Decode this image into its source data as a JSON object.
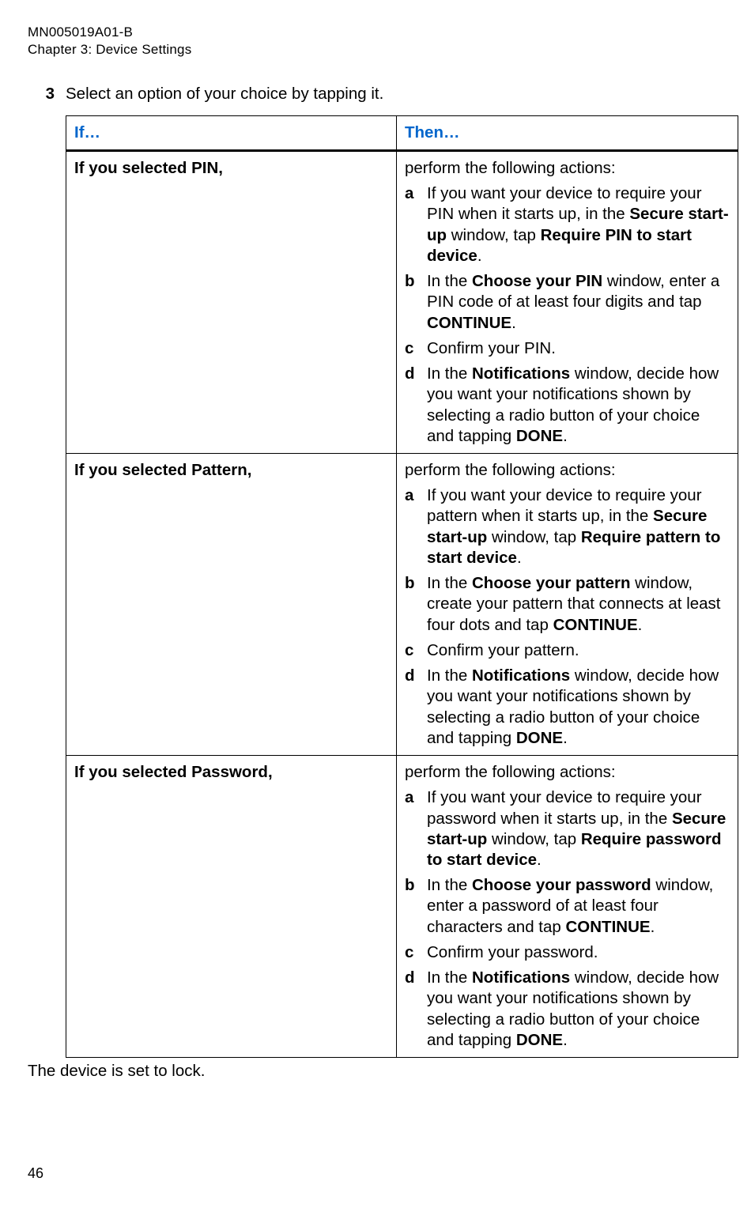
{
  "header": {
    "doc_id": "MN005019A01-B",
    "chapter": "Chapter 3:  Device Settings"
  },
  "step": {
    "num": "3",
    "text": "Select an option of your choice by tapping it."
  },
  "table": {
    "h1": "If…",
    "h2": "Then…",
    "rows": [
      {
        "if": "If you selected PIN,",
        "lead": "perform the following actions:",
        "items": [
          {
            "marker": "a",
            "pre": "If you want your device to require your PIN when it starts up, in the ",
            "b1": "Secure start-up",
            "mid1": " window, tap ",
            "b2": "Require PIN to start device",
            "post": "."
          },
          {
            "marker": "b",
            "pre": "In the ",
            "b1": "Choose your PIN",
            "mid1": " window, enter a PIN code of at least four digits and tap ",
            "b2": "CONTINUE",
            "post": "."
          },
          {
            "marker": "c",
            "text": "Confirm your PIN."
          },
          {
            "marker": "d",
            "pre": "In the ",
            "b1": "Notifications",
            "mid1": " window, decide how you want your notifications shown by selecting a radio button of your choice and tapping ",
            "b2": "DONE",
            "post": "."
          }
        ]
      },
      {
        "if": "If you selected Pattern,",
        "lead": "perform the following actions:",
        "items": [
          {
            "marker": "a",
            "pre": "If you want your device to require your pattern when it starts up, in the ",
            "b1": "Secure start-up",
            "mid1": " window, tap ",
            "b2": "Require pattern to start device",
            "post": "."
          },
          {
            "marker": "b",
            "pre": "In the ",
            "b1": "Choose your pattern",
            "mid1": " window, create your pattern that connects at least four dots and tap ",
            "b2": "CONTINUE",
            "post": "."
          },
          {
            "marker": "c",
            "text": "Confirm your pattern."
          },
          {
            "marker": "d",
            "pre": "In the ",
            "b1": "Notifications",
            "mid1": " window, decide how you want your notifications shown by selecting a radio button of your choice and tapping ",
            "b2": "DONE",
            "post": "."
          }
        ]
      },
      {
        "if": "If you selected Password,",
        "lead": "perform the following actions:",
        "items": [
          {
            "marker": "a",
            "pre": "If you want your device to require your password when it starts up, in the ",
            "b1": "Secure start-up",
            "mid1": " window, tap ",
            "b2": "Require password to start device",
            "post": "."
          },
          {
            "marker": "b",
            "pre": "In the ",
            "b1": "Choose your password",
            "mid1": " window, enter a password of at least four characters and tap ",
            "b2": "CONTINUE",
            "post": "."
          },
          {
            "marker": "c",
            "text": "Confirm your password."
          },
          {
            "marker": "d",
            "pre": "In the ",
            "b1": "Notifications",
            "mid1": " window, decide how you want your notifications shown by selecting a radio button of your choice and tapping ",
            "b2": "DONE",
            "post": "."
          }
        ]
      }
    ]
  },
  "closing": "The device is set to lock.",
  "pagenum": "46"
}
